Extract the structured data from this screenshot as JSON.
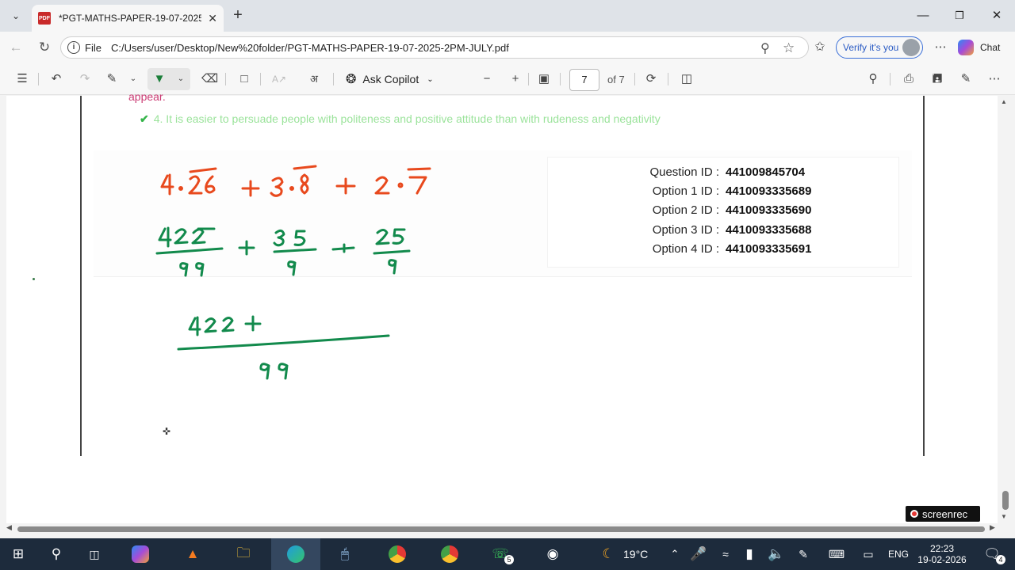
{
  "browser": {
    "tab_title": "*PGT-MATHS-PAPER-19-07-2025-...",
    "url_scheme": "File",
    "url": "C:/Users/user/Desktop/New%20folder/PGT-MATHS-PAPER-19-07-2025-2PM-JULY.pdf",
    "verify_label": "Verify it's you",
    "chat_label": "Chat"
  },
  "pdf_toolbar": {
    "ask_copilot": "Ask Copilot",
    "page_number": "7",
    "page_total": "of 7"
  },
  "document": {
    "partial_line": "appear.",
    "option4_text": "4. It is easier to persuade people with politeness and positive attitude than with rudeness and negativity",
    "ids": [
      {
        "label": "Question ID :",
        "value": "441009845704"
      },
      {
        "label": "Option 1 ID :",
        "value": "4410093335689"
      },
      {
        "label": "Option 2 ID :",
        "value": "4410093335690"
      },
      {
        "label": "Option 3 ID :",
        "value": "4410093335688"
      },
      {
        "label": "Option 4 ID :",
        "value": "4410093335691"
      }
    ],
    "handwriting": {
      "line1": "4.26 + 3.8 + 2.7",
      "line2": "422/99 + 35/9 + 25/9",
      "line3": "422 + / 99",
      "line1_color": "#e8491d",
      "ink_color": "#128a4c"
    }
  },
  "overlay": {
    "screenrec_label": "screenrec"
  },
  "taskbar": {
    "weather_temp": "19°C",
    "language": "ENG",
    "time": "22:23",
    "date": "19-02-2026",
    "whatsapp_badge": "5",
    "notification_badge": "4"
  },
  "colors": {
    "accent": "#3a6fd8",
    "taskbar": "#1d2b3c",
    "option_green": "#9be39b"
  }
}
